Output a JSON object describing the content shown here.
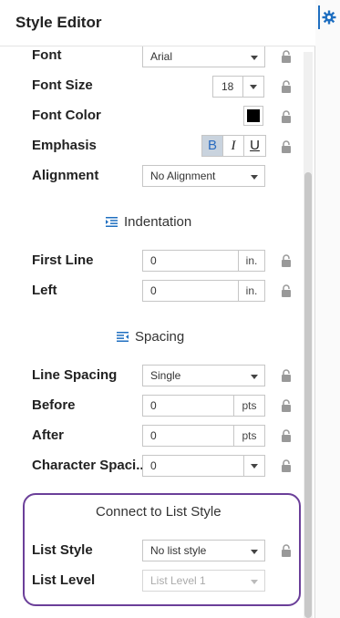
{
  "header": {
    "title": "Style Editor"
  },
  "text_section": {
    "font": {
      "label": "Font",
      "value": "Arial"
    },
    "font_size": {
      "label": "Font Size",
      "value": "18"
    },
    "font_color": {
      "label": "Font Color",
      "color": "#000000"
    },
    "emphasis": {
      "label": "Emphasis",
      "bold": "B",
      "italic": "I",
      "underline": "U"
    },
    "alignment": {
      "label": "Alignment",
      "value": "No Alignment"
    }
  },
  "indentation": {
    "title": "Indentation",
    "first_line": {
      "label": "First Line",
      "value": "0",
      "unit": "in."
    },
    "left": {
      "label": "Left",
      "value": "0",
      "unit": "in."
    }
  },
  "spacing": {
    "title": "Spacing",
    "line_spacing": {
      "label": "Line Spacing",
      "value": "Single"
    },
    "before": {
      "label": "Before",
      "value": "0",
      "unit": "pts"
    },
    "after": {
      "label": "After",
      "value": "0",
      "unit": "pts"
    },
    "character_spacing": {
      "label": "Character Spaci...",
      "value": "0"
    }
  },
  "list_style_section": {
    "title": "Connect to List Style",
    "list_style": {
      "label": "List Style",
      "value": "No list style"
    },
    "list_level": {
      "label": "List Level",
      "value": "List Level 1"
    }
  },
  "colors": {
    "accent": "#1f6fc0",
    "highlight_border": "#6b3f99",
    "bold_active_bg": "#c9d3de"
  },
  "icons": [
    "gear-icon",
    "lock-icon",
    "indent-icon",
    "spacing-icon",
    "chevron-down-icon"
  ]
}
